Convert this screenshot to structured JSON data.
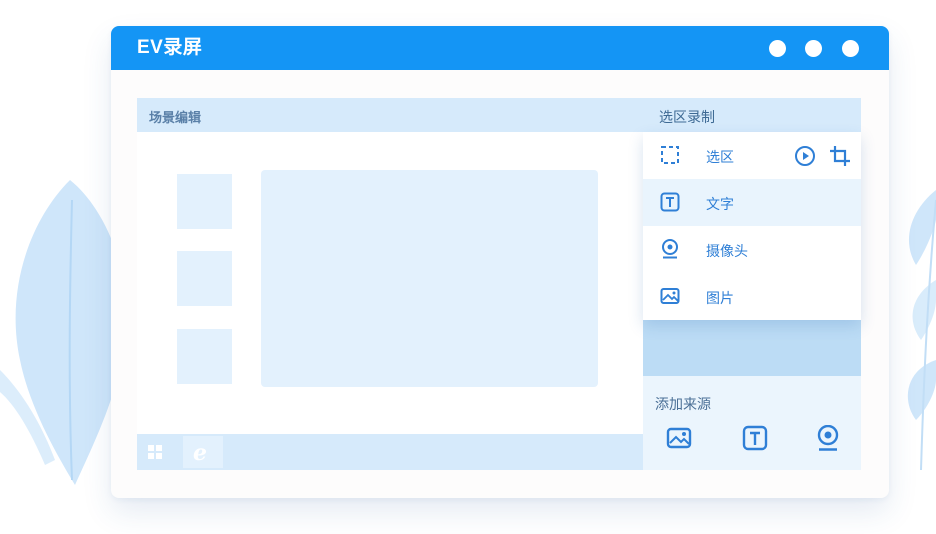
{
  "app": {
    "title": "EV录屏",
    "window_controls": [
      "minimize-dot",
      "maximize-dot",
      "close-dot"
    ]
  },
  "colors": {
    "brand": "#1495f5",
    "panel_header": "#d6eafb",
    "placeholder": "#e3f1fd",
    "icon_blue": "#2f7fd6"
  },
  "scene_panel": {
    "title": "场景编辑",
    "taskbar_icons": [
      "windows-start-icon",
      "internet-explorer-icon"
    ],
    "ie_glyph": "e"
  },
  "region_panel": {
    "title": "选区录制",
    "menu": [
      {
        "label": "选区",
        "icon": "selection-icon",
        "selected": false
      },
      {
        "label": "文字",
        "icon": "text-icon",
        "selected": true
      },
      {
        "label": "摄像头",
        "icon": "camera-icon",
        "selected": false
      },
      {
        "label": "图片",
        "icon": "image-icon",
        "selected": false
      }
    ],
    "row_actions": [
      "play-icon",
      "crop-icon"
    ]
  },
  "add_source": {
    "title": "添加来源",
    "buttons": [
      {
        "icon": "image-icon"
      },
      {
        "icon": "text-icon"
      },
      {
        "icon": "camera-icon"
      }
    ]
  }
}
